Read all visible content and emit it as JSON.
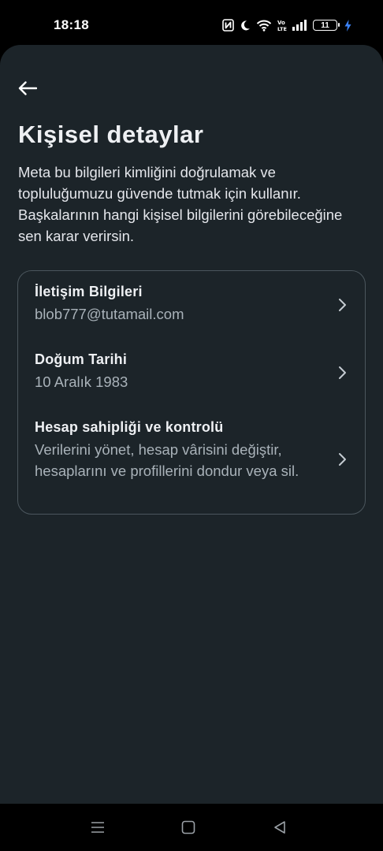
{
  "status_bar": {
    "time": "18:18",
    "battery_level": "11",
    "icons": [
      "nfc-icon",
      "moon-icon",
      "wifi-icon",
      "volte-icon",
      "signal-icon",
      "battery-icon",
      "charging-icon"
    ],
    "volte_label": "Vo LTE"
  },
  "header": {
    "back_icon": "arrow-left-icon",
    "title": "Kişisel detaylar",
    "description": "Meta bu bilgileri kimliğini doğrulamak ve topluluğumuzu güvende tutmak için kullanır. Başkalarının hangi kişisel bilgilerini görebileceğine sen karar verirsin."
  },
  "settings": {
    "items": [
      {
        "title": "İletişim Bilgileri",
        "subtitle": "blob777@tutamail.com",
        "icon": "chevron-right-icon"
      },
      {
        "title": "Doğum Tarihi",
        "subtitle": "10 Aralık 1983",
        "icon": "chevron-right-icon"
      },
      {
        "title": "Hesap sahipliği ve kontrolü",
        "subtitle": "Verilerini yönet, hesap vârisini değiştir, hesaplarını ve profillerini dondur veya sil.",
        "icon": "chevron-right-icon"
      }
    ]
  },
  "nav_bar": {
    "icons": [
      "menu-icon",
      "home-square-icon",
      "back-triangle-icon"
    ]
  },
  "colors": {
    "background": "#1c2429",
    "text_primary": "#eef0f3",
    "text_secondary": "#a9b2b9",
    "card_border": "#4b565d"
  }
}
